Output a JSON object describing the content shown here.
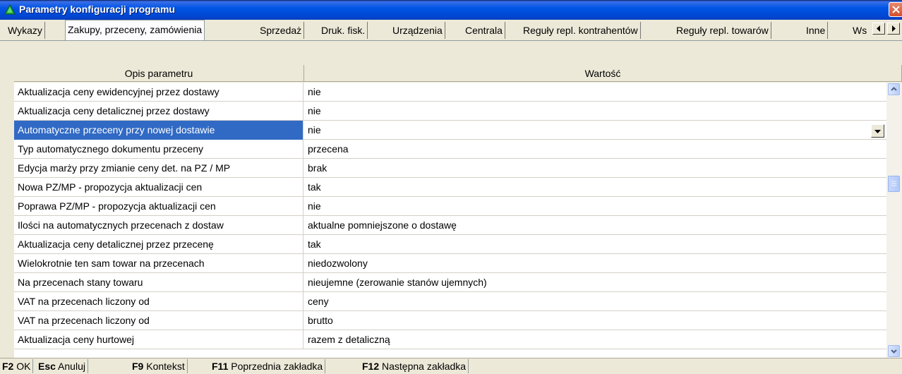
{
  "window": {
    "title": "Parametry konfiguracji programu",
    "icon": "green-triangle-icon",
    "close": "close-icon"
  },
  "tabs": [
    {
      "label": "Wykazy"
    },
    {
      "label": "Zakupy, przeceny, zamówienia"
    },
    {
      "label": "Sprzedaż"
    },
    {
      "label": "Druk. fisk."
    },
    {
      "label": "Urządzenia"
    },
    {
      "label": "Centrala"
    },
    {
      "label": "Reguły repl. kontrahentów"
    },
    {
      "label": "Reguły repl. towarów"
    },
    {
      "label": "Inne"
    },
    {
      "label": "Ws"
    }
  ],
  "active_tab": "Zakupy, przeceny, zamówienia",
  "grid": {
    "columns": [
      "Opis parametru",
      "Wartość"
    ],
    "rows": [
      {
        "name": "Aktualizacja ceny ewidencyjnej przez dostawy",
        "value": "nie"
      },
      {
        "name": "Aktualizacja ceny detalicznej przez dostawy",
        "value": "nie"
      },
      {
        "name": "Automatyczne przeceny przy nowej dostawie",
        "value": "nie"
      },
      {
        "name": "Typ automatycznego dokumentu przeceny",
        "value": "przecena"
      },
      {
        "name": "Edycja marży przy zmianie ceny det. na PZ / MP",
        "value": "brak"
      },
      {
        "name": "Nowa PZ/MP - propozycja aktualizacji cen",
        "value": "tak"
      },
      {
        "name": "Poprawa PZ/MP - propozycja aktualizacji cen",
        "value": "nie"
      },
      {
        "name": "Ilości na automatycznych przecenach z dostaw",
        "value": "aktualne pomniejszone o dostawę"
      },
      {
        "name": "Aktualizacja ceny detalicznej przez przecenę",
        "value": "tak"
      },
      {
        "name": "Wielokrotnie ten sam towar na przecenach",
        "value": "niedozwolony"
      },
      {
        "name": "Na przecenach stany towaru",
        "value": "nieujemne (zerowanie stanów ujemnych)"
      },
      {
        "name": "VAT na przecenach liczony od",
        "value": "ceny"
      },
      {
        "name": "VAT na przecenach liczony od",
        "value": "brutto"
      },
      {
        "name": "Aktualizacja ceny hurtowej",
        "value": "razem z detaliczną"
      }
    ]
  },
  "statusbar": [
    {
      "key": "F2",
      "label": "OK"
    },
    {
      "key": "Esc",
      "label": "Anuluj"
    },
    {
      "key": "F9",
      "label": "Kontekst"
    },
    {
      "key": "F11",
      "label": "Poprzednia zakładka"
    },
    {
      "key": "F12",
      "label": "Następna zakładka"
    }
  ]
}
